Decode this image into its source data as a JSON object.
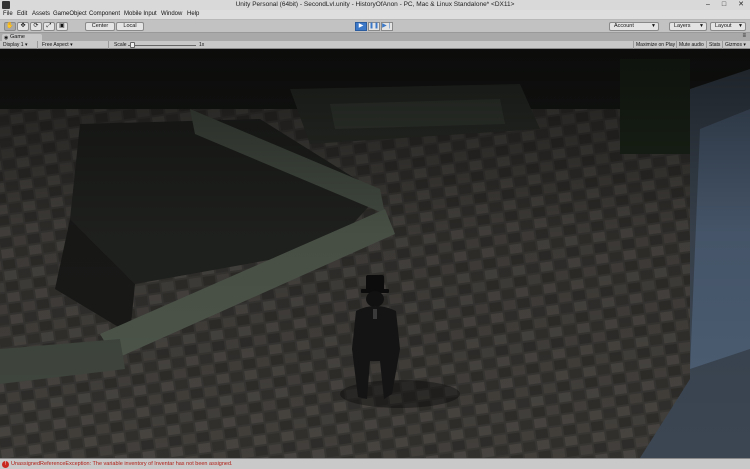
{
  "window": {
    "title": "Unity Personal (64bit) - SecondLvl.unity - HistoryOfAnon - PC, Mac & Linux Standalone* <DX11>",
    "minimize": "–",
    "maximize": "□",
    "close": "✕"
  },
  "menu": [
    "File",
    "Edit",
    "Assets",
    "GameObject",
    "Component",
    "Mobile Input",
    "Window",
    "Help"
  ],
  "toolbar": {
    "tools": [
      "✋",
      "✥",
      "⟳",
      "⤢",
      "▣"
    ],
    "pivot_label": "Center",
    "space_label": "Local",
    "play": "▶",
    "pause": "❚❚",
    "step": "▶❘",
    "account_label": "Account",
    "layers_label": "Layers",
    "layout_label": "Layout"
  },
  "panel": {
    "tab_label": "Game",
    "display": "Display 1",
    "aspect": "Free Aspect",
    "scale_label": "Scale",
    "scale_value": "1x",
    "maximize_on_play": "Maximize on Play",
    "mute_audio": "Mute audio",
    "stats": "Stats",
    "gizmos": "Gizmos"
  },
  "status": {
    "message": "UnassignedReferenceException: The variable inventory of Inventar has not been assigned."
  },
  "colors": {
    "accent": "#3b78c8",
    "error": "#b01d14"
  }
}
